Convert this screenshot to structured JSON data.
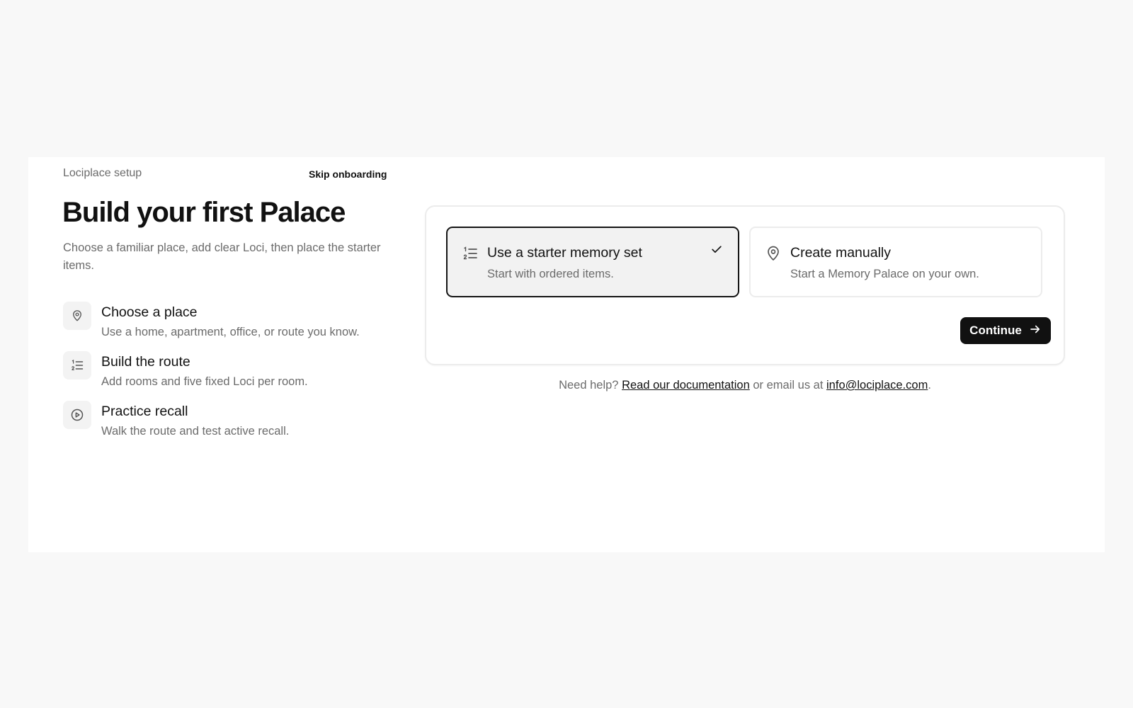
{
  "header": {
    "app_name": "Lociplace setup",
    "skip_label": "Skip onboarding"
  },
  "intro": {
    "title": "Build your first Palace",
    "subtitle": "Choose a familiar place, add clear Loci, then place the starter items."
  },
  "steps": [
    {
      "icon": "map-pin-icon",
      "title": "Choose a place",
      "desc": "Use a home, apartment, office, or route you know."
    },
    {
      "icon": "numbered-list-icon",
      "title": "Build the route",
      "desc": "Add rooms and five fixed Loci per room."
    },
    {
      "icon": "play-circle-icon",
      "title": "Practice recall",
      "desc": "Walk the route and test active recall."
    }
  ],
  "options": [
    {
      "icon": "numbered-list-icon",
      "title": "Use a starter memory set",
      "desc": "Start with ordered items.",
      "selected": true
    },
    {
      "icon": "map-pin-icon",
      "title": "Create manually",
      "desc": "Start a Memory Palace on your own.",
      "selected": false
    }
  ],
  "continue_label": "Continue",
  "help": {
    "prefix": "Need help?",
    "docs_link": "Read our documentation",
    "middle": "or email us at",
    "email_link": "info@lociplace.com",
    "suffix": "."
  }
}
